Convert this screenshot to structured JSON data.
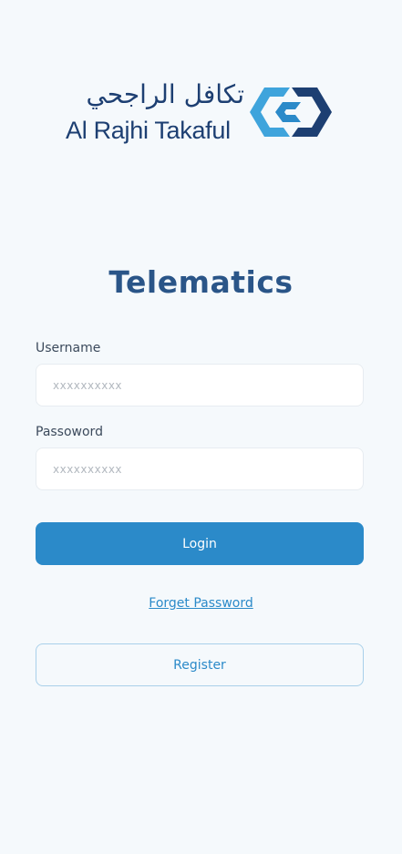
{
  "logo": {
    "arabic": "تكافل الراجحي",
    "english": "Al Rajhi Takaful",
    "colors": {
      "navy": "#1d3f72",
      "blue": "#2b8ac9",
      "light_blue": "#3fa4dc"
    }
  },
  "title": "Telematics",
  "form": {
    "username": {
      "label": "Username",
      "placeholder": "xxxxxxxxxx",
      "value": ""
    },
    "password": {
      "label": "Passoword",
      "placeholder": "xxxxxxxxxx",
      "value": ""
    },
    "login_label": "Login",
    "forgot_label": "Forget Password",
    "register_label": "Register"
  },
  "colors": {
    "background": "#f5f9fc",
    "primary": "#2b8ac9",
    "title": "#2a5588"
  }
}
